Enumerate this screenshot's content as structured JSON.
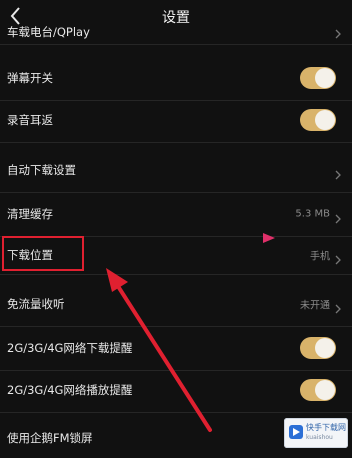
{
  "header": {
    "title": "设置",
    "back_icon": "back-chevron-icon"
  },
  "settings": {
    "row_partial": {
      "label": "车载电台/QPlay"
    },
    "danmaku": {
      "label": "弹幕开关",
      "toggle_on": true
    },
    "record_return": {
      "label": "录音耳返",
      "toggle_on": true
    },
    "auto_download": {
      "label": "自动下载设置"
    },
    "clear_cache": {
      "label": "清理缓存",
      "value": "5.3 MB"
    },
    "download_location": {
      "label": "下载位置",
      "value": "手机"
    },
    "free_data": {
      "label": "免流量收听",
      "value": "未开通"
    },
    "download_reminder": {
      "label": "2G/3G/4G网络下载提醒",
      "toggle_on": true
    },
    "play_reminder": {
      "label": "2G/3G/4G网络播放提醒",
      "toggle_on": true
    },
    "lock_screen": {
      "label": "使用企鹅FM锁屏"
    }
  },
  "colors": {
    "background": "#111111",
    "toggle_on": "#d9b36a",
    "annotation_red": "#e02030"
  },
  "watermark": {
    "title": "快手下载网",
    "sub": "kuaishou"
  }
}
